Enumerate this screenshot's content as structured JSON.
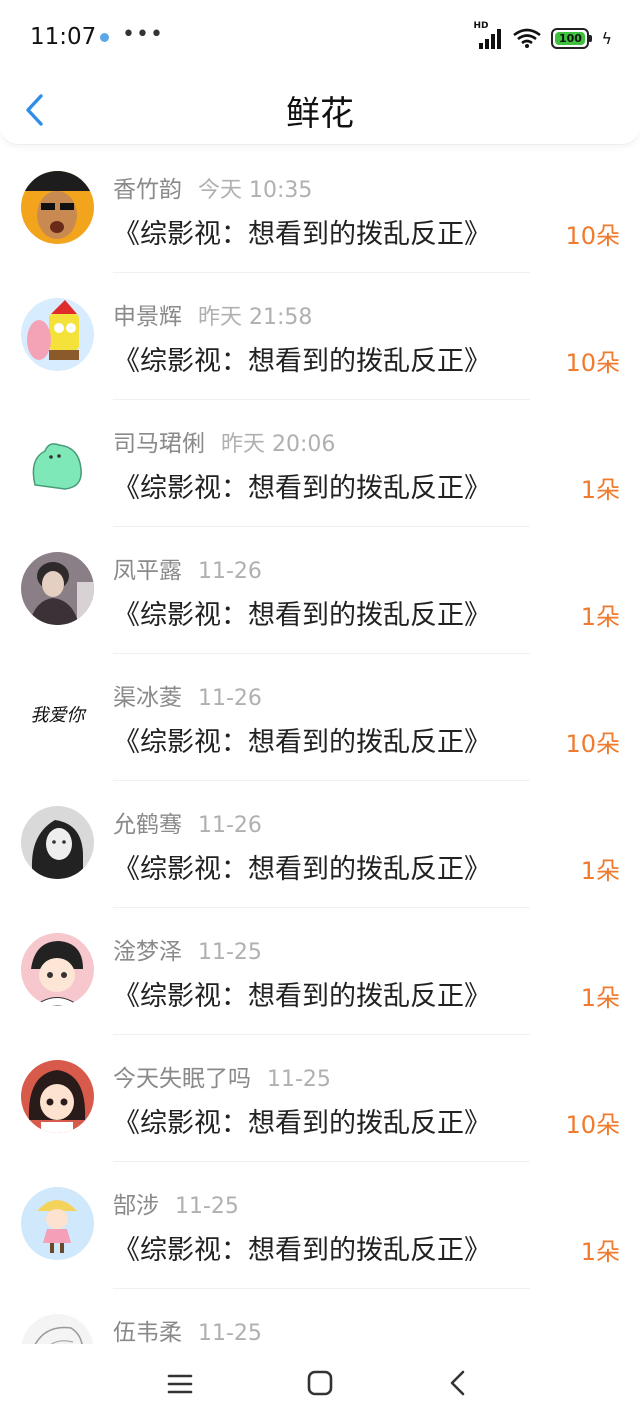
{
  "status": {
    "time": "11:07",
    "more": "•••",
    "network": "HD",
    "battery": "100"
  },
  "header": {
    "title": "鲜花"
  },
  "items": [
    {
      "name": "香竹韵",
      "time": "今天 10:35",
      "work": "《综影视：想看到的拨乱反正》",
      "count": "10朵"
    },
    {
      "name": "申景辉",
      "time": "昨天 21:58",
      "work": "《综影视：想看到的拨乱反正》",
      "count": "10朵"
    },
    {
      "name": "司马珺俐",
      "time": "昨天 20:06",
      "work": "《综影视：想看到的拨乱反正》",
      "count": "1朵"
    },
    {
      "name": "凤平露",
      "time": "11-26",
      "work": "《综影视：想看到的拨乱反正》",
      "count": "1朵"
    },
    {
      "name": "渠冰菱",
      "time": "11-26",
      "work": "《综影视：想看到的拨乱反正》",
      "count": "10朵",
      "avatar_text": "我爱你"
    },
    {
      "name": "允鹤骞",
      "time": "11-26",
      "work": "《综影视：想看到的拨乱反正》",
      "count": "1朵"
    },
    {
      "name": "淦梦泽",
      "time": "11-25",
      "work": "《综影视：想看到的拨乱反正》",
      "count": "1朵"
    },
    {
      "name": "今天失眠了吗",
      "time": "11-25",
      "work": "《综影视：想看到的拨乱反正》",
      "count": "10朵"
    },
    {
      "name": "郜涉",
      "time": "11-25",
      "work": "《综影视：想看到的拨乱反正》",
      "count": "1朵"
    },
    {
      "name": "伍韦柔",
      "time": "11-25"
    }
  ],
  "colors": {
    "accent": "#f07a2e",
    "back": "#2f8ee8",
    "name": "#8a8a8a",
    "time": "#b0b0b0"
  },
  "icons": [
    "back-arrow-icon",
    "signal-icon",
    "wifi-icon",
    "battery-icon",
    "menu-icon",
    "home-icon",
    "nav-back-icon"
  ]
}
